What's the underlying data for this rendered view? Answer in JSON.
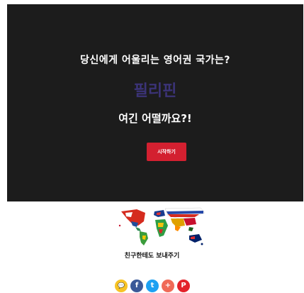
{
  "hero": {
    "question": "당신에게 어울리는 영어권 국가는?",
    "country": "필리핀",
    "tagline": "여긴 어떨까요?!",
    "start_label": "시작하기"
  },
  "share": {
    "title": "친구한테도 보내주기",
    "buttons": [
      {
        "name": "kakaotalk",
        "glyph": "💬",
        "color": "#f7c325"
      },
      {
        "name": "facebook",
        "glyph": "f",
        "color": "#3b5998"
      },
      {
        "name": "twitter",
        "glyph": "t",
        "color": "#1da1f2"
      },
      {
        "name": "more",
        "glyph": "+",
        "color": "#f06a57"
      },
      {
        "name": "pinterest",
        "glyph": "P",
        "color": "#e3222a"
      }
    ]
  }
}
